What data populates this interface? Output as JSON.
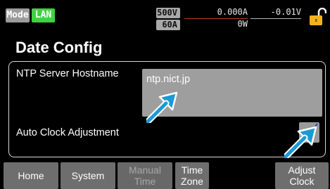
{
  "status_bar": {
    "mode_label": "Mode",
    "lan_label": "LAN",
    "voltage_rating": "500V",
    "current_rating": "60A",
    "current_reading": "0.000A",
    "voltage_reading": "-0.01V",
    "power_reading": "0W",
    "lock_icon": "unlocked-padlock-icon"
  },
  "page": {
    "title": "Date Config"
  },
  "settings": {
    "ntp_label": "NTP Server Hostname",
    "ntp_value": "ntp.nict.jp",
    "auto_clock_label": "Auto Clock Adjustment",
    "auto_clock_checked": true
  },
  "softkeys": [
    {
      "label": "Home",
      "enabled": true
    },
    {
      "label": "System",
      "enabled": true
    },
    {
      "label": "Manual\nTime",
      "enabled": false
    },
    {
      "label": "Time\nZone",
      "enabled": true
    },
    {
      "label": "Adjust\nClock",
      "enabled": true
    }
  ],
  "colors": {
    "background": "#000000",
    "lan_badge": "#3fd240",
    "mode_badge": "#9b9b9b",
    "field": "#9e9e9e",
    "arrow": "#1a9ad6",
    "checkmark": "#1a3fb0",
    "lock": "#f2b21c"
  }
}
